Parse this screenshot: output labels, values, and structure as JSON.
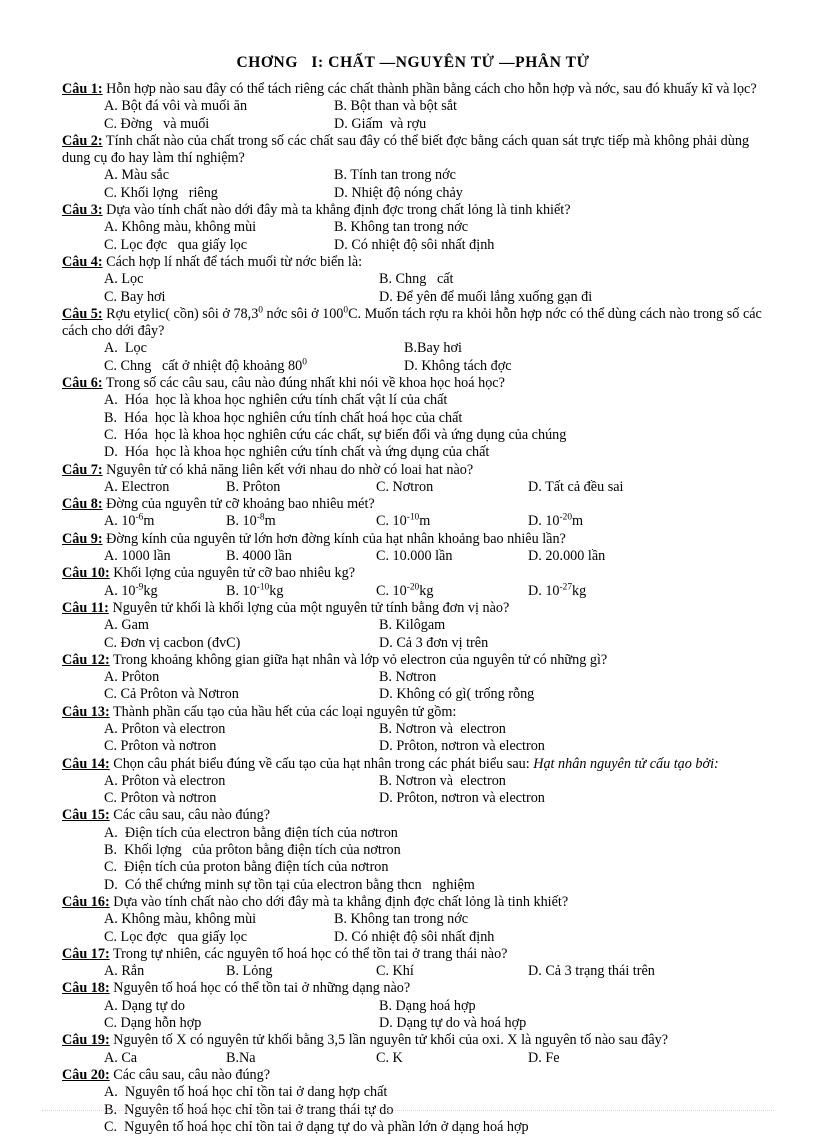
{
  "document": {
    "title": "CHƠNG   I: CHẤT —NGUYÊN TỬ —PHÂN TỬ"
  },
  "questions": [
    {
      "label": "Câu 1:",
      "stem": " Hỗn hợp nào sau đây  có thể tách riêng các chất thành phần bằng cách cho hỗn hợp và nớc,  sau đó khuấy kĩ và lọc?",
      "options": [
        "A. Bột đá vôi và muối ăn",
        "B. Bột than và bột sắt",
        "C. Đờng   và muối",
        "D. Giấm  và rợu"
      ]
    },
    {
      "label": "Câu 2:",
      "stem": " Tính chất nào của chất trong số các chất sau đây có thể biết đợc  bằng cách quan sát trực tiếp mà không phải dùng dung cụ đo hay làm thí nghiệm?",
      "options": [
        "A. Màu sắc",
        "B. Tính tan trong nớc",
        "C. Khối lợng   riêng",
        "D. Nhiệt độ nóng chảy"
      ]
    },
    {
      "label": "Câu 3:",
      "stem": " Dựa vào tính chất nào dới   đây mà ta khẳng định đợc  trong chất lỏng là tinh khiết?",
      "options": [
        "A. Không màu, không mùi",
        "B. Không tan trong nớc",
        "C. Lọc đợc   qua giấy lọc",
        "D. Có nhiệt độ sôi nhất định"
      ]
    },
    {
      "label": "Câu 4:",
      "stem": " Cách hợp lí nhất để tách muối từ nớc   biển là:",
      "options": [
        "A. Lọc",
        "B. Chng   cất",
        "C. Bay hơi",
        "D. Để yên để muối lắng xuống gạn đi"
      ]
    },
    {
      "label": "Câu 5:",
      "stem_parts": [
        " Rợu   etylic( cồn) sôi ở 78,3",
        "0",
        " nớc   sôi ở 100",
        "0",
        "C. Muốn tách rợu   ra khỏi hỗn hợp nớc   có thể dùng cách nào trong số các cách cho dới   đây?"
      ],
      "options_parts": [
        {
          "text": "A.  Lọc"
        },
        {
          "text": "B.Bay hơi"
        },
        {
          "text": "C. Chng   cất ở nhiệt độ khoảng 80",
          "sup": "0"
        },
        {
          "text": "D. Không tách đợc"
        }
      ]
    },
    {
      "label": "Câu 6:",
      "stem": " Trong số các câu sau, câu nào đúng nhất khi nói về khoa học hoá học?",
      "options_stacked": [
        "A.  Hóa  học là khoa học nghiên cứu tính chất vật lí của chất",
        "B.  Hóa  học là khoa học nghiên cứu tính chất hoá học của chất",
        "C.  Hóa  học là khoa học nghiên cứu các chất, sự biến đổi và ứng dụng của chúng",
        "D.  Hóa  học là khoa học nghiên cứu tính chất và ứng dụng của chất"
      ]
    },
    {
      "label": "Câu 7:",
      "stem": " Nguyên tử có khả năng liên kết với nhau do nhờ có loai hat nào?",
      "options_quad": [
        "A. Electron",
        "B. Prôton",
        "C. Nơtron",
        "D. Tất cả đều sai"
      ]
    },
    {
      "label": "Câu 8:",
      "stem": " Đờng   của nguyên tử cỡ khoảng bao nhiêu mét?",
      "options_sup": [
        {
          "pre": "A. 10",
          "sup": "-6",
          "post": "m"
        },
        {
          "pre": "B. 10",
          "sup": "-8",
          "post": "m"
        },
        {
          "pre": "C. 10",
          "sup": "-10",
          "post": "m"
        },
        {
          "pre": "D. 10",
          "sup": "-20",
          "post": "m"
        }
      ]
    },
    {
      "label": "Câu 9:",
      "stem": " Đờng   kính của nguyên tử lớn hơn đờng   kính của hạt nhân khoảng bao nhiêu lần?",
      "options_quad": [
        "A. 1000 lần",
        "B. 4000 lần",
        "C. 10.000 lần",
        "D. 20.000 lần"
      ]
    },
    {
      "label": "Câu 10:",
      "stem": " Khối lợng   của nguyên tử cỡ bao nhiêu kg?",
      "options_sup": [
        {
          "pre": "A. 10",
          "sup": "-9",
          "post": "kg"
        },
        {
          "pre": "B. 10",
          "sup": "-10",
          "post": "kg"
        },
        {
          "pre": "C. 10",
          "sup": "-20",
          "post": "kg"
        },
        {
          "pre": "D. 10",
          "sup": "-27",
          "post": "kg"
        }
      ]
    },
    {
      "label": "Câu 11:",
      "stem": " Nguyên tử khối là khối lợng   của một nguyên tử tính bằng đơn vị nào?",
      "options": [
        "A. Gam",
        "B. Kilôgam",
        "C. Đơn vị cacbon (đvC)",
        "D. Cả 3 đơn vị trên"
      ]
    },
    {
      "label": "Câu 12:",
      "stem": " Trong khoảng không gian giữa hạt nhân và lớp vỏ electron  của nguyên tử có những gì?",
      "options": [
        "A. Prôton",
        "B. Nơtron",
        "C. Cả Prôton và Nơtron",
        "D. Không có gì( trống rỗng"
      ]
    },
    {
      "label": "Câu 13:",
      "stem": " Thành phần cấu tạo của hầu hết của các loại nguyên tử gồm:",
      "options": [
        "A. Prôton và electron",
        "B. Nơtron và  electron",
        "C. Prôton và nơtron",
        "D. Prôton, nơtron và electron"
      ]
    },
    {
      "label": "Câu 14:",
      "stem": " Chọn câu phát biểu đúng về cấu tạo của hạt nhân trong các phát biểu sau: ",
      "stem_italic": "Hạt nhân nguyên  tử cấu tạo bởi:",
      "options": [
        "A. Prôton và electron",
        "B. Nơtron và  electron",
        "C. Prôton và nơtron",
        "D. Prôton, nơtron và electron"
      ]
    },
    {
      "label": "Câu 15:",
      "stem": " Các câu sau, câu nào đúng?",
      "options_stacked": [
        "A.  Điện tích của electron bằng điện tích của nơtron",
        "B.  Khối lợng   của prôton bằng điện tích của nơtron",
        "C.  Điện tích của proton bằng điện tích của nơtron",
        "D.  Có thể chứng minh sự tồn tại của electron bằng thcn   nghiệm"
      ]
    },
    {
      "label": "Câu 16:",
      "stem": " Dựa vào tính chất nào cho dới   đây mà ta khẳng định đợc   chất lỏng là tinh khiết?",
      "options": [
        "A. Không màu, không mùi",
        "B. Không tan trong nớc",
        "C. Lọc đợc   qua giấy lọc",
        "D. Có nhiệt độ sôi nhất định"
      ]
    },
    {
      "label": "Câu 17:",
      "stem": " Trong tự nhiên, các nguyên tố hoá học có thể tồn tai ở trang thái nào?",
      "options_quad": [
        "A. Rắn",
        "B. Lỏng",
        "C. Khí",
        "D. Cả 3 trạng thái trên"
      ]
    },
    {
      "label": "Câu 18:",
      "stem": " Nguyên tố hoá học có thể tồn tai ở những dạng nào?",
      "options": [
        "A. Dạng tự do",
        "B. Dạng hoá hợp",
        "C. Dạng hỗn hợp",
        "D. Dạng tự do và hoá hợp"
      ]
    },
    {
      "label": "Câu 19:",
      "stem": " Nguyên tố X có nguyên tử khối bằng 3,5 lần nguyên tử khối của oxi. X là nguyên tố nào sau đây?",
      "options_quad": [
        "A. Ca",
        "B.Na",
        "C. K",
        "D. Fe"
      ]
    },
    {
      "label": "Câu 20:",
      "stem": " Các câu sau, câu nào đúng?",
      "options_stacked": [
        "A.  Nguyên tố hoá học chỉ tồn tai ở dang hợp chất",
        "B.  Nguyên tố hoá học chỉ tồn tai ở trang thái tự do",
        "C.  Nguyên tố hoá học chỉ tồn tai ở dạng tự do và phần lớn ở dạng hoá hợp"
      ]
    }
  ]
}
